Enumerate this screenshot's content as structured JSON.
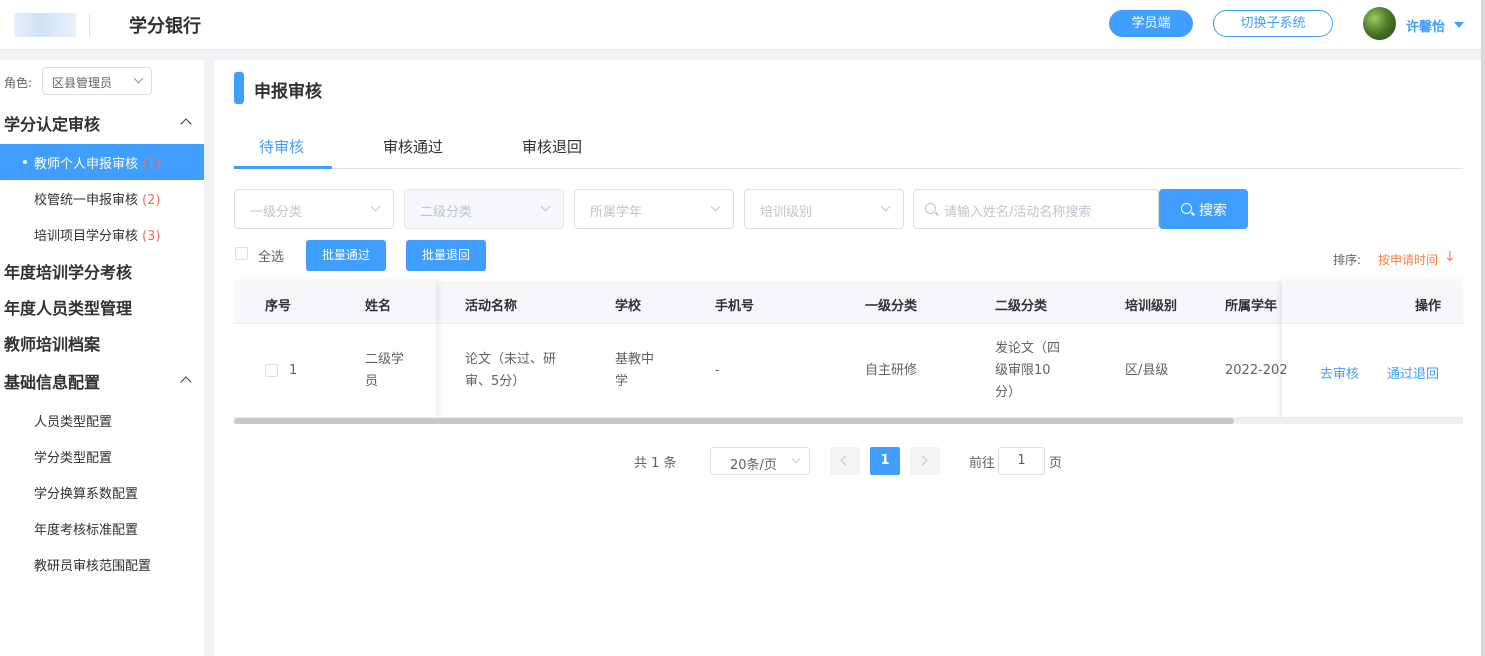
{
  "header": {
    "app_title": "学分银行",
    "student_button": "学员端",
    "switch_button": "切换子系统",
    "user_name": "许馨怡"
  },
  "sidebar": {
    "role_label": "角色:",
    "role_value": "区县管理员",
    "groups": [
      {
        "label": "学分认定审核",
        "expanded": true
      },
      {
        "label": "年度培训学分考核"
      },
      {
        "label": "年度人员类型管理"
      },
      {
        "label": "教师培训档案"
      },
      {
        "label": "基础信息配置",
        "expanded": true
      }
    ],
    "review_items": [
      {
        "label": "教师个人申报审核",
        "count": "(1)",
        "active": true
      },
      {
        "label": "校管统一申报审核",
        "count": "(2)"
      },
      {
        "label": "培训项目学分审核",
        "count": "(3)"
      }
    ],
    "config_items": [
      {
        "label": "人员类型配置"
      },
      {
        "label": "学分类型配置"
      },
      {
        "label": "学分换算系数配置"
      },
      {
        "label": "年度考核标准配置"
      },
      {
        "label": "教研员审核范围配置"
      }
    ]
  },
  "main": {
    "title": "申报审核",
    "tabs": [
      {
        "label": "待审核",
        "active": true
      },
      {
        "label": "审核通过"
      },
      {
        "label": "审核退回"
      }
    ],
    "filters": {
      "level1": "一级分类",
      "level2": "二级分类",
      "year": "所属学年",
      "training_level": "培训级别",
      "search_placeholder": "请输入姓名/活动名称搜索",
      "search_button": "搜索"
    },
    "select_all": "全选",
    "batch_pass": "批量通过",
    "batch_return": "批量退回",
    "sort_label": "排序:",
    "sort_value": "按申请时间",
    "sort_arrow": "↓",
    "table": {
      "columns": [
        "序号",
        "姓名",
        "活动名称",
        "学校",
        "手机号",
        "一级分类",
        "二级分类",
        "培训级别",
        "所属学年",
        "操作"
      ],
      "rows": [
        {
          "index": "1",
          "name_l1": "二级学",
          "name_l2": "员",
          "activity_l1": "论文（未过、研",
          "activity_l2": "审、5分）",
          "school_l1": "基教中",
          "school_l2": "学",
          "phone": "-",
          "category1": "自主研修",
          "category2_l1": "发论文（四",
          "category2_l2": "级审限10",
          "category2_l3": "分）",
          "training_level": "区/县级",
          "year": "2022-202",
          "actions": [
            "去审核",
            "通过",
            "退回"
          ]
        }
      ]
    },
    "pagination": {
      "total": "共 1 条",
      "page_size": "20条/页",
      "current_page": "1",
      "goto_label": "前往",
      "goto_value": "1",
      "page_suffix": "页"
    }
  },
  "colors": {
    "accent": "#409eff",
    "badge_red": "#f56c6c",
    "sort_orange": "#ff7f3f"
  }
}
